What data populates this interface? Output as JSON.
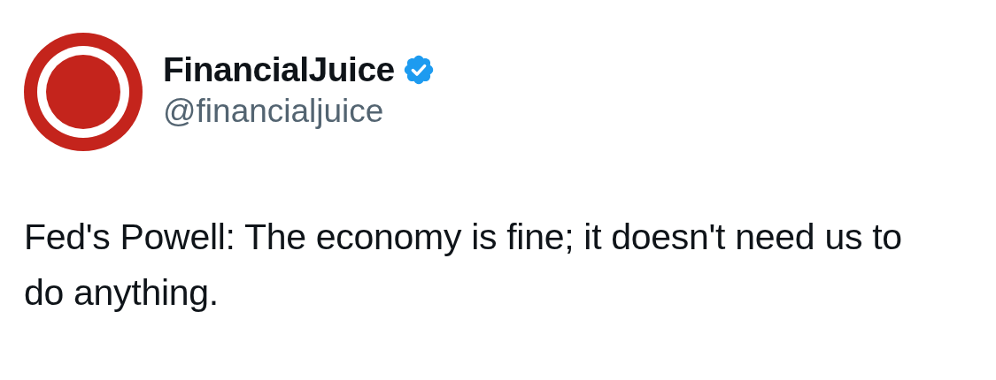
{
  "author": {
    "name": "FinancialJuice",
    "verified": true,
    "handle": "@financialjuice"
  },
  "post": {
    "text": "Fed's Powell: The economy is fine; it doesn't need us to do anything."
  }
}
